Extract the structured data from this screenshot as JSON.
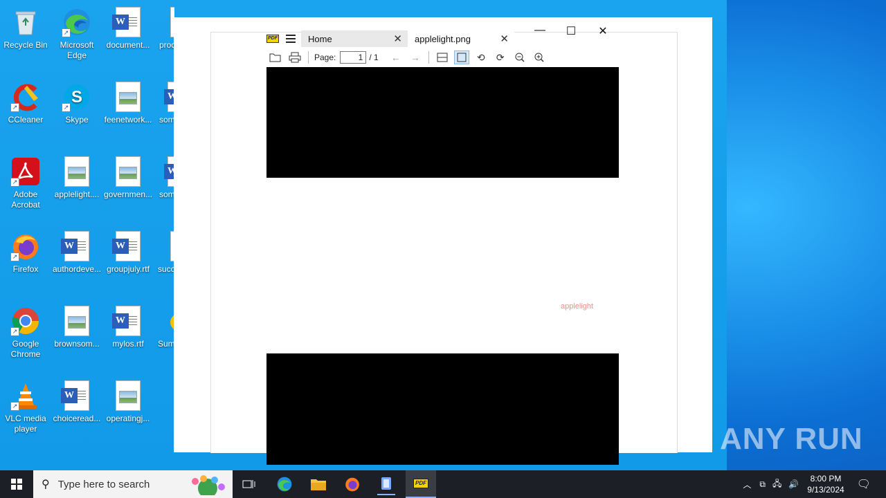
{
  "desktop": {
    "icons": [
      {
        "label": "Recycle Bin",
        "icon": "recycle-bin-icon"
      },
      {
        "label": "Microsoft Edge",
        "icon": "edge-icon"
      },
      {
        "label": "document...",
        "icon": "word-doc-icon"
      },
      {
        "label": "prod",
        "icon": "file-icon"
      },
      {
        "label": "CCleaner",
        "icon": "ccleaner-icon"
      },
      {
        "label": "Skype",
        "icon": "skype-icon"
      },
      {
        "label": "feenetwork...",
        "icon": "image-file-icon"
      },
      {
        "label": "som",
        "icon": "word-doc-icon"
      },
      {
        "label": "Adobe Acrobat",
        "icon": "acrobat-icon"
      },
      {
        "label": "applelight....",
        "icon": "image-file-icon"
      },
      {
        "label": "governmen...",
        "icon": "image-file-icon"
      },
      {
        "label": "som",
        "icon": "word-doc-icon"
      },
      {
        "label": "Firefox",
        "icon": "firefox-icon"
      },
      {
        "label": "authordeve...",
        "icon": "word-doc-icon"
      },
      {
        "label": "groupjuly.rtf",
        "icon": "word-doc-icon"
      },
      {
        "label": "succ",
        "icon": "file-icon"
      },
      {
        "label": "Google Chrome",
        "icon": "chrome-icon"
      },
      {
        "label": "brownsom...",
        "icon": "image-file-icon"
      },
      {
        "label": "mylos.rtf",
        "icon": "word-doc-icon"
      },
      {
        "label": "Sum",
        "icon": "app-icon"
      },
      {
        "label": "VLC media player",
        "icon": "vlc-icon"
      },
      {
        "label": "choiceread...",
        "icon": "word-doc-icon"
      },
      {
        "label": "operatingj...",
        "icon": "image-file-icon"
      }
    ]
  },
  "viewer": {
    "tabs": [
      {
        "label": "Home"
      },
      {
        "label": "applelight.png"
      }
    ],
    "toolbar": {
      "page_label": "Page:",
      "page_value": "1",
      "page_total": "/ 1"
    },
    "document_text": "applelight",
    "app_logo_text": "PDF"
  },
  "watermark": "ANY RUN",
  "taskbar": {
    "search_placeholder": "Type here to search",
    "time": "8:00 PM",
    "date": "9/13/2024"
  }
}
